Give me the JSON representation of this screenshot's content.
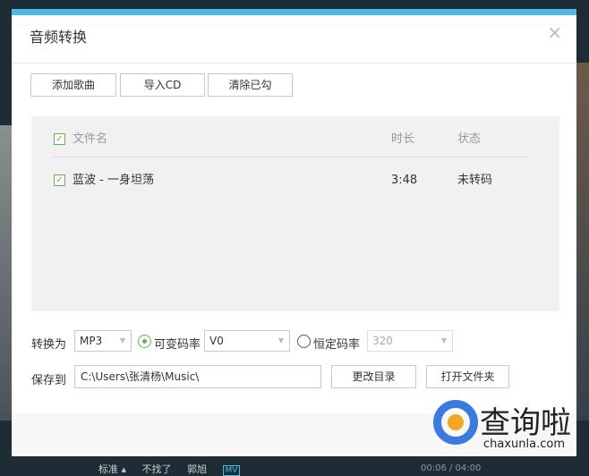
{
  "dialog": {
    "title": "音频转换",
    "close": "×"
  },
  "toolbar": {
    "add": "添加歌曲",
    "import_cd": "导入CD",
    "clear": "清除已勾"
  },
  "table": {
    "headers": {
      "name": "文件名",
      "duration": "时长",
      "status": "状态"
    },
    "rows": [
      {
        "name": "蓝波 - 一身坦荡",
        "duration": "3:48",
        "status": "未转码",
        "checked": true
      }
    ]
  },
  "convert": {
    "label": "转换为",
    "format": "MP3",
    "vbr_label": "可变码率",
    "vbr_value": "V0",
    "cbr_label": "恒定码率",
    "cbr_value": "320",
    "selected": "vbr"
  },
  "save": {
    "label": "保存到",
    "path": "C:\\Users\\张清杨\\Music\\",
    "change_dir": "更改目录",
    "open_folder": "打开文件夹"
  },
  "watermark": {
    "title": "查询啦",
    "url": "chaxunla.com"
  },
  "player": {
    "quality": "标准 ▴",
    "song": "不找了",
    "artist": "郭旭",
    "mv": "MV",
    "time": "00:06 / 04:00"
  }
}
